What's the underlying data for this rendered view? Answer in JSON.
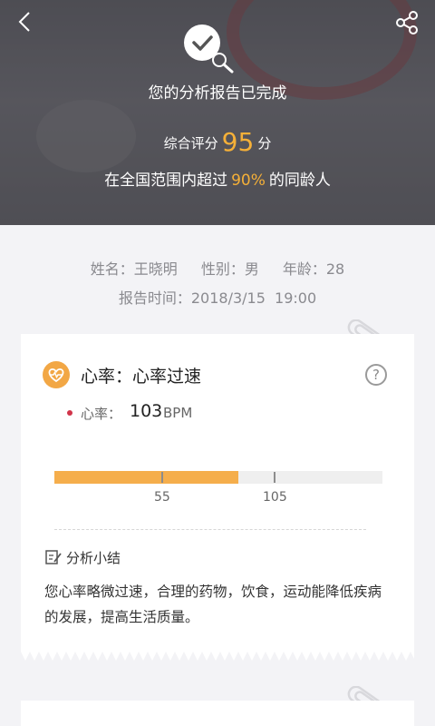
{
  "header": {
    "title": "您的分析报告已完成",
    "score_prefix": "综合评分",
    "score": "95",
    "score_suffix": "分",
    "percent_prefix": "在全国范围内超过",
    "percent": "90%",
    "percent_suffix": "的同龄人"
  },
  "patient": {
    "name_label": "姓名：",
    "name": "王晓明",
    "gender_label": "性别：",
    "gender": "男",
    "age_label": "年龄：",
    "age": "28",
    "time_label": "报告时间：",
    "time": "2018/3/15  19:00"
  },
  "card": {
    "title": "心率：心率过速",
    "metric_label": "心率：",
    "metric_value": "103",
    "metric_unit": "BPM",
    "range_low": "55",
    "range_high": "105",
    "fill_fraction": 0.56,
    "summary_title": "分析小结",
    "summary_text": "您心率略微过速，合理的药物，饮食，运动能降低疾病的发展，提高生活质量。"
  },
  "colors": {
    "accent": "#f5b038",
    "bar_fill": "#f5ae4c",
    "dot": "#d1344a"
  },
  "icons": [
    "back-icon",
    "share-icon",
    "check-search-icon",
    "heart-pulse-icon",
    "help-icon",
    "edit-note-icon",
    "paperclip-icon"
  ]
}
